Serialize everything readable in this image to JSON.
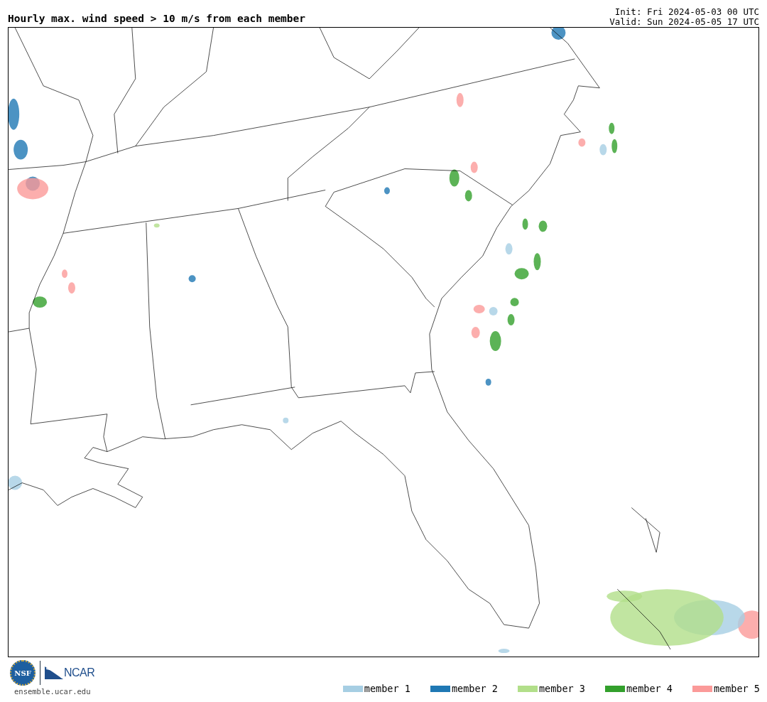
{
  "title": "Hourly max. wind speed > 10 m/s from each member",
  "init": "Init: Fri 2024-05-03 00 UTC",
  "valid": "Valid: Sun 2024-05-05 17 UTC",
  "logos": {
    "nsf": "NSF",
    "ncar": "NCAR"
  },
  "site": "ensemble.ucar.edu",
  "legend": [
    {
      "label": "member 1",
      "color": "#a6cee3"
    },
    {
      "label": "member 2",
      "color": "#1f78b4"
    },
    {
      "label": "member 3",
      "color": "#b2df8a"
    },
    {
      "label": "member 4",
      "color": "#33a02c"
    },
    {
      "label": "member 5",
      "color": "#fb9a99"
    }
  ]
}
